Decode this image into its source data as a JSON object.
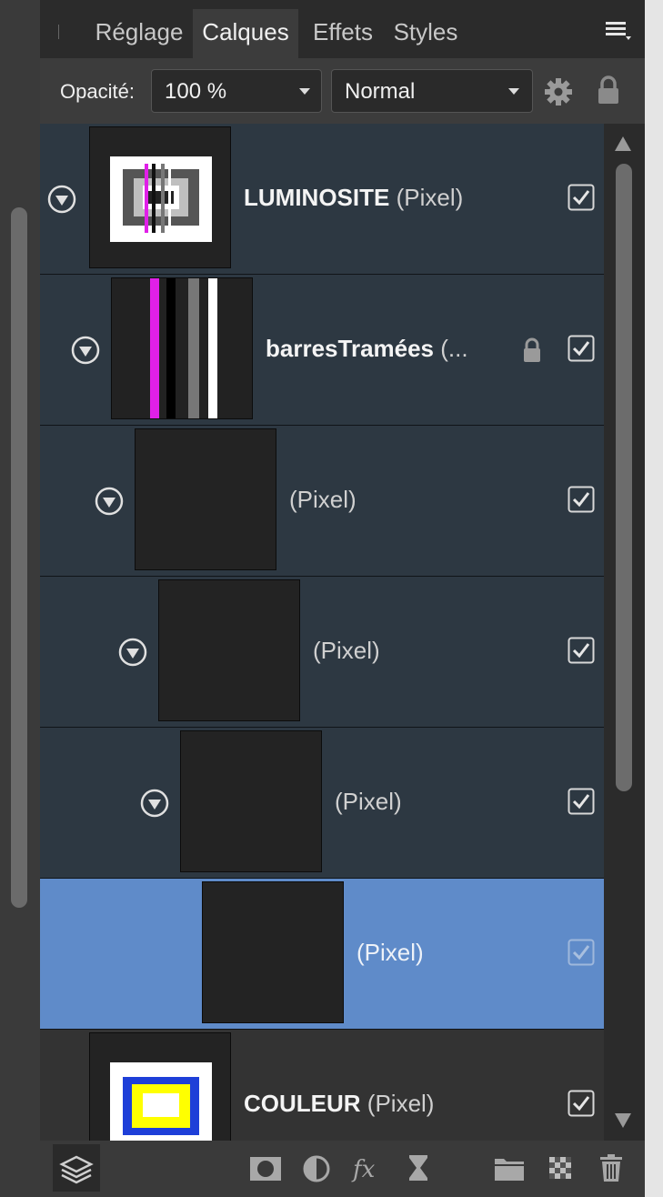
{
  "tabs": [
    {
      "label": "Réglage"
    },
    {
      "label": "Calques"
    },
    {
      "label": "Effets"
    },
    {
      "label": "Styles"
    }
  ],
  "active_tab": "Calques",
  "toolbar": {
    "opacity_label": "Opacité:",
    "opacity_value": "100 %",
    "blend_mode": "Normal"
  },
  "layers": [
    {
      "name": "LUMINOSITE",
      "kind": "(Pixel)",
      "visible": true,
      "locked": false,
      "selected": false
    },
    {
      "name": "barresTramées",
      "kind": "(...",
      "visible": true,
      "locked": true,
      "selected": false
    },
    {
      "name": "",
      "kind": "(Pixel)",
      "visible": true,
      "locked": false,
      "selected": false
    },
    {
      "name": "",
      "kind": "(Pixel)",
      "visible": true,
      "locked": false,
      "selected": false
    },
    {
      "name": "",
      "kind": "(Pixel)",
      "visible": true,
      "locked": false,
      "selected": false
    },
    {
      "name": "",
      "kind": "(Pixel)",
      "visible": true,
      "locked": false,
      "selected": true
    },
    {
      "name": "COULEUR",
      "kind": "(Pixel)",
      "visible": true,
      "locked": false,
      "selected": false
    }
  ],
  "colors": {
    "panel_bg": "#2b2b2b",
    "row_bg": "#2d3842",
    "selected_bg": "#5f8bc9",
    "tab_active_bg": "#3c3c3c",
    "magenta_bar": "#e020e8",
    "blue_frame": "#1e3fd8",
    "yellow_frame": "#ffff00"
  },
  "bottom_icons": [
    "layers-panel-icon",
    "add-mask-icon",
    "add-adjustment-icon",
    "fx-icon",
    "live-filter-icon",
    "add-group-icon",
    "add-pixel-layer-icon",
    "delete-icon"
  ]
}
